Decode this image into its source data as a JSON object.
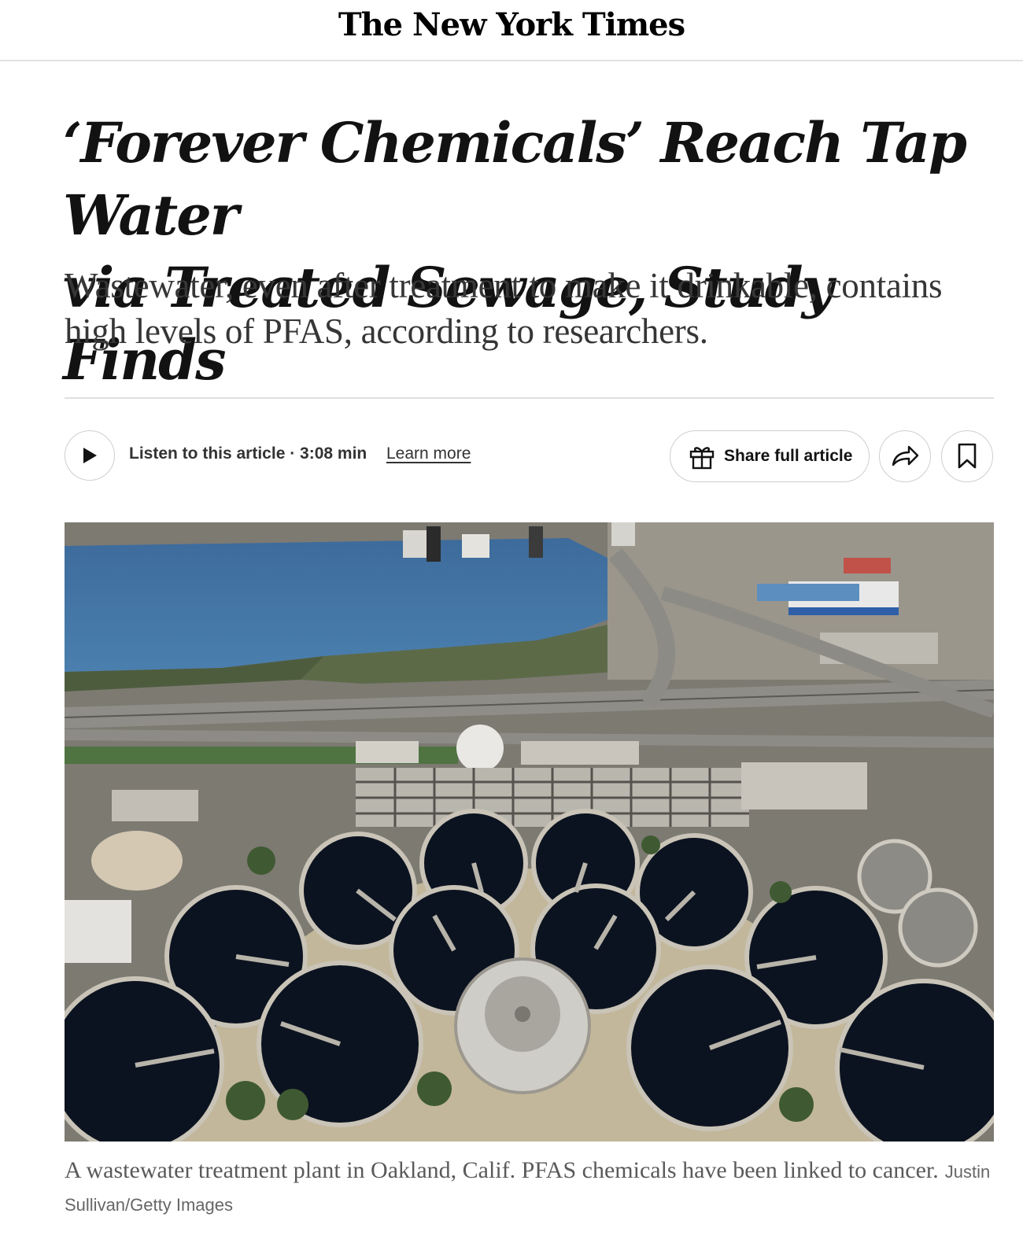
{
  "masthead": {
    "logo": "The New York Times"
  },
  "article": {
    "headline_line1": "‘Forever Chemicals’ Reach Tap Water",
    "headline_line2": "via Treated Sewage, Study Finds",
    "summary": "Wastewater, even after treatment to make it drinkable, contains high levels of PFAS, according to researchers."
  },
  "audio": {
    "listen_label": "Listen to this article · 3:08 min",
    "learn_more": "Learn more"
  },
  "actions": {
    "share_label": "Share full article",
    "icons": [
      "play-icon",
      "gift-icon",
      "share-arrow-icon",
      "bookmark-icon"
    ]
  },
  "photo": {
    "caption": "A wastewater treatment plant in Oakland, Calif. PFAS chemicals have been linked to cancer.",
    "credit": "Justin Sullivan/Getty Images"
  }
}
